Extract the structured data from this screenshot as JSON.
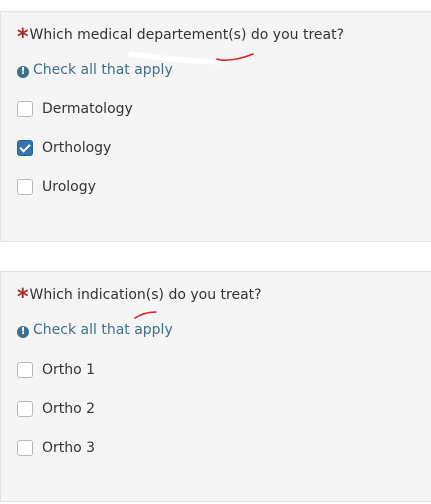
{
  "questions": [
    {
      "required_mark": "*",
      "text": "Which medical departement(s) do you treat?",
      "hint": "Check all that apply",
      "options": [
        {
          "label": "Dermatology",
          "checked": false
        },
        {
          "label": "Orthology",
          "checked": true
        },
        {
          "label": "Urology",
          "checked": false
        }
      ]
    },
    {
      "required_mark": "*",
      "text": "Which indication(s) do you treat?",
      "hint": "Check all that apply",
      "options": [
        {
          "label": "Ortho 1",
          "checked": false
        },
        {
          "label": "Ortho 2",
          "checked": false
        },
        {
          "label": "Ortho 3",
          "checked": false
        }
      ]
    }
  ],
  "colors": {
    "required": "#a32d2d",
    "hint": "#3e6f8c",
    "checkbox_checked": "#3274b2",
    "annotation": "#d9232a"
  },
  "icons": {
    "hint": "info-circle-icon",
    "check": "checkmark-icon"
  }
}
